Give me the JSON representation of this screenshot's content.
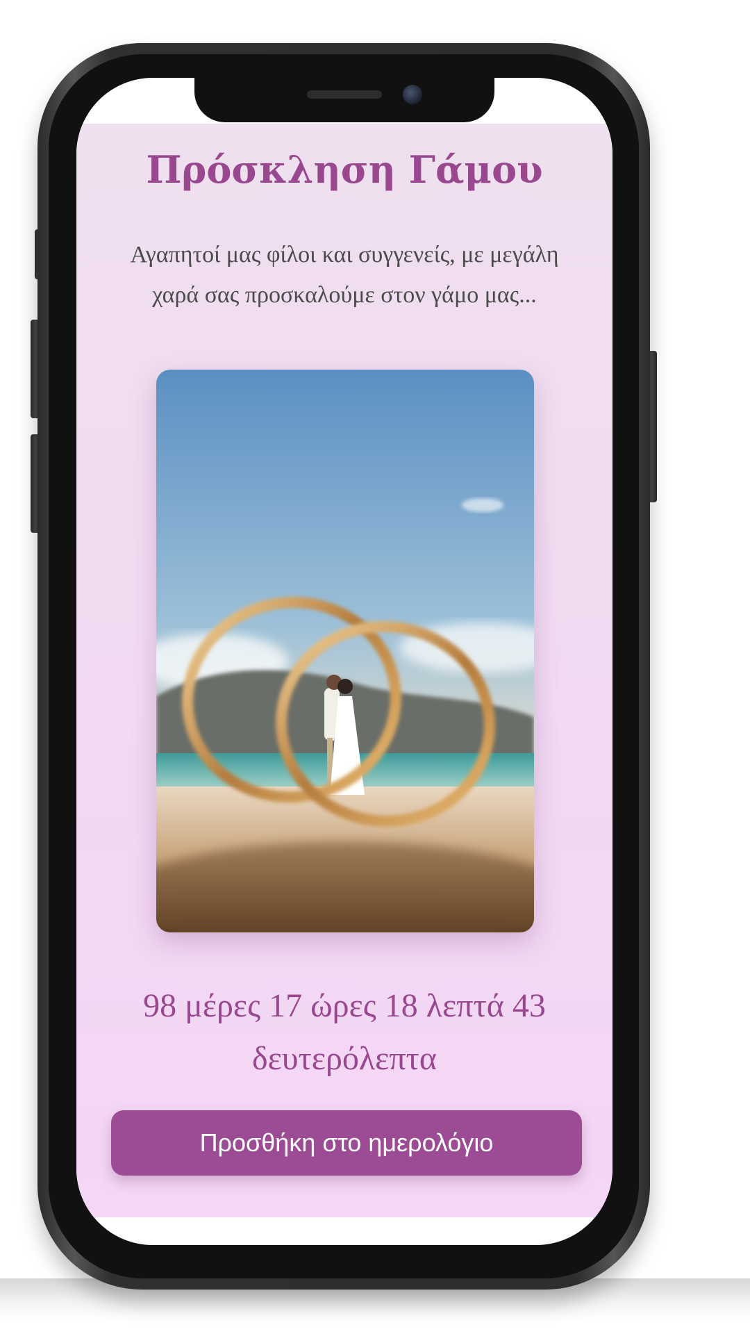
{
  "invitation": {
    "title": "Πρόσκληση Γάμου",
    "intro": "Αγαπητοί μας φίλοι και συγγενείς, με μεγάλη χαρά σας προσκαλούμε στον γάμο μας...",
    "countdown": "98 μέρες 17 ώρες 18 λεπτά 43 δευτερόλεπτα",
    "calendar_button_label": "Προσθήκη στο ημερολόγιο"
  },
  "colors": {
    "accent": "#9c4c94",
    "title": "#99488f",
    "background": "#f1d9f2",
    "body_text": "#4b4b4b"
  },
  "photo": {
    "subject": "couple kissing on beach framed by two wedding rings"
  }
}
